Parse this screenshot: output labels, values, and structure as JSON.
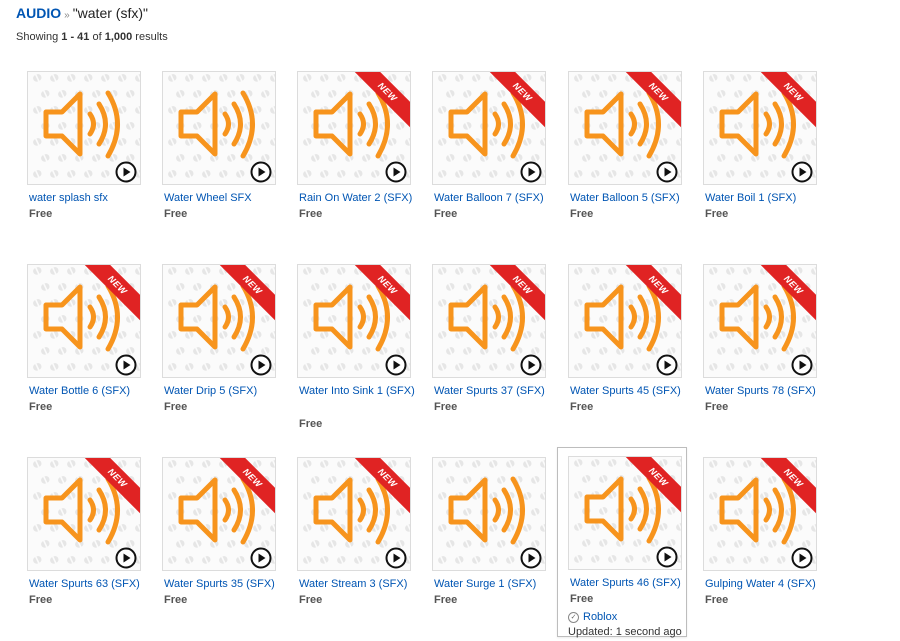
{
  "breadcrumb": {
    "category": "AUDIO",
    "separator": "»",
    "query": "\"water (sfx)\""
  },
  "results": {
    "prefix": "Showing ",
    "range": "1 - 41",
    "of": " of ",
    "total": "1,000",
    "suffix": " results"
  },
  "colors": {
    "speaker": "#f7941d",
    "link": "#0055b3",
    "ribbon": "#e02323"
  },
  "ribbon_label": "NEW",
  "icons": {
    "thumbnail": "speaker-icon",
    "play": "play-icon",
    "verified": "checkmark-icon"
  },
  "items": [
    {
      "name": "water splash sfx",
      "price": "Free",
      "is_new": false
    },
    {
      "name": "Water Wheel SFX",
      "price": "Free",
      "is_new": false
    },
    {
      "name": "Rain On Water 2 (SFX)",
      "price": "Free",
      "is_new": true
    },
    {
      "name": "Water Balloon 7 (SFX)",
      "price": "Free",
      "is_new": true
    },
    {
      "name": "Water Balloon 5 (SFX)",
      "price": "Free",
      "is_new": true
    },
    {
      "name": "Water Boil 1 (SFX)",
      "price": "Free",
      "is_new": true
    },
    {
      "name": "Water Bottle 6 (SFX)",
      "price": "Free",
      "is_new": true
    },
    {
      "name": "Water Drip 5 (SFX)",
      "price": "Free",
      "is_new": true
    },
    {
      "name": "Water Into Sink 1 (SFX)",
      "price": "Free",
      "is_new": true
    },
    {
      "name": "Water Spurts 37 (SFX)",
      "price": "Free",
      "is_new": true
    },
    {
      "name": "Water Spurts 45 (SFX)",
      "price": "Free",
      "is_new": true
    },
    {
      "name": "Water Spurts 78 (SFX)",
      "price": "Free",
      "is_new": true
    },
    {
      "name": "Water Spurts 63 (SFX)",
      "price": "Free",
      "is_new": true
    },
    {
      "name": "Water Spurts 35 (SFX)",
      "price": "Free",
      "is_new": true
    },
    {
      "name": "Water Stream 3 (SFX)",
      "price": "Free",
      "is_new": true
    },
    {
      "name": "Water Surge 1 (SFX)",
      "price": "Free",
      "is_new": false
    },
    {
      "name": "Water Spurts 46 (SFX)",
      "price": "Free",
      "is_new": true,
      "hovered": true,
      "creator": "Roblox",
      "updated": "Updated: 1 second ago"
    },
    {
      "name": "Gulping Water 4 (SFX)",
      "price": "Free",
      "is_new": true
    }
  ]
}
